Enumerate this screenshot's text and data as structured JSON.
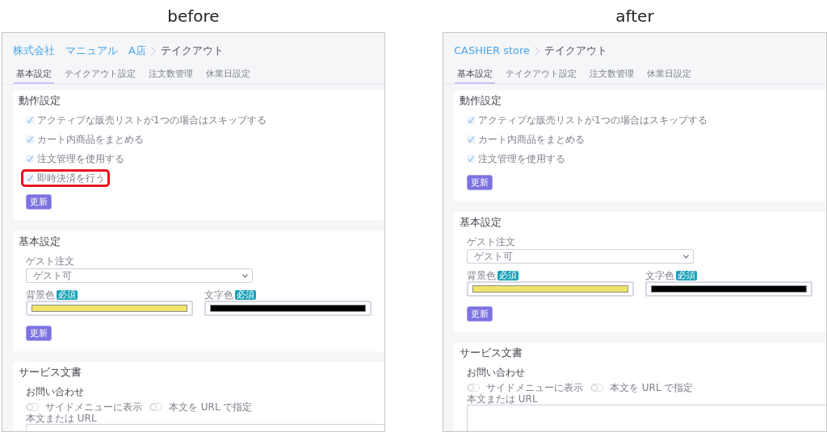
{
  "panels": [
    {
      "caption": "before",
      "breadcrumb": [
        {
          "label": "株式会社　マニュアル　A店",
          "kind": "link"
        },
        {
          "label": "テイクアウト",
          "kind": "current"
        }
      ],
      "tabs": [
        {
          "label": "基本設定",
          "selected": true
        },
        {
          "label": "テイクアウト設定",
          "selected": false
        },
        {
          "label": "注文数管理",
          "selected": false
        },
        {
          "label": "休業日設定",
          "selected": false
        }
      ],
      "behavior_settings": {
        "title": "動作設定",
        "options": [
          {
            "label": "アクティブな販売リストが1つの場合はスキップする",
            "checked": true,
            "highlighted": false
          },
          {
            "label": "カート内商品をまとめる",
            "checked": true,
            "highlighted": false
          },
          {
            "label": "注文管理を使用する",
            "checked": true,
            "highlighted": false
          },
          {
            "label": "即時決済を行う",
            "checked": true,
            "highlighted": true
          }
        ],
        "button": "更新"
      },
      "basic_settings": {
        "title": "基本設定",
        "guest_order": {
          "label": "ゲスト注文",
          "value": "ゲスト可"
        },
        "colors": [
          {
            "label": "背景色",
            "badge": "必須",
            "color": "#f0e46a"
          },
          {
            "label": "文字色",
            "badge": "必須",
            "color": "#000000"
          }
        ],
        "button": "更新"
      },
      "service_documents": {
        "title": "サービス文書",
        "section": "お問い合わせ",
        "toggles": [
          {
            "label": "サイドメニューに表示",
            "on": false
          },
          {
            "label": "本文を URL で指定",
            "on": false
          }
        ],
        "body_label": "本文または URL"
      }
    },
    {
      "caption": "after",
      "breadcrumb": [
        {
          "label": "CASHIER store",
          "kind": "link"
        },
        {
          "label": "テイクアウト",
          "kind": "current"
        }
      ],
      "tabs": [
        {
          "label": "基本設定",
          "selected": true
        },
        {
          "label": "テイクアウト設定",
          "selected": false
        },
        {
          "label": "注文数管理",
          "selected": false
        },
        {
          "label": "休業日設定",
          "selected": false
        }
      ],
      "behavior_settings": {
        "title": "動作設定",
        "options": [
          {
            "label": "アクティブな販売リストが1つの場合はスキップする",
            "checked": true,
            "highlighted": false
          },
          {
            "label": "カート内商品をまとめる",
            "checked": true,
            "highlighted": false
          },
          {
            "label": "注文管理を使用する",
            "checked": true,
            "highlighted": false
          }
        ],
        "button": "更新"
      },
      "basic_settings": {
        "title": "基本設定",
        "guest_order": {
          "label": "ゲスト注文",
          "value": "ゲスト可"
        },
        "colors": [
          {
            "label": "背景色",
            "badge": "必須",
            "color": "#f0e46a"
          },
          {
            "label": "文字色",
            "badge": "必須",
            "color": "#000000"
          }
        ],
        "button": "更新"
      },
      "service_documents": {
        "title": "サービス文書",
        "section": "お問い合わせ",
        "toggles": [
          {
            "label": "サイドメニューに表示",
            "on": false
          },
          {
            "label": "本文を URL で指定",
            "on": false
          }
        ],
        "body_label": "本文または URL"
      }
    }
  ]
}
